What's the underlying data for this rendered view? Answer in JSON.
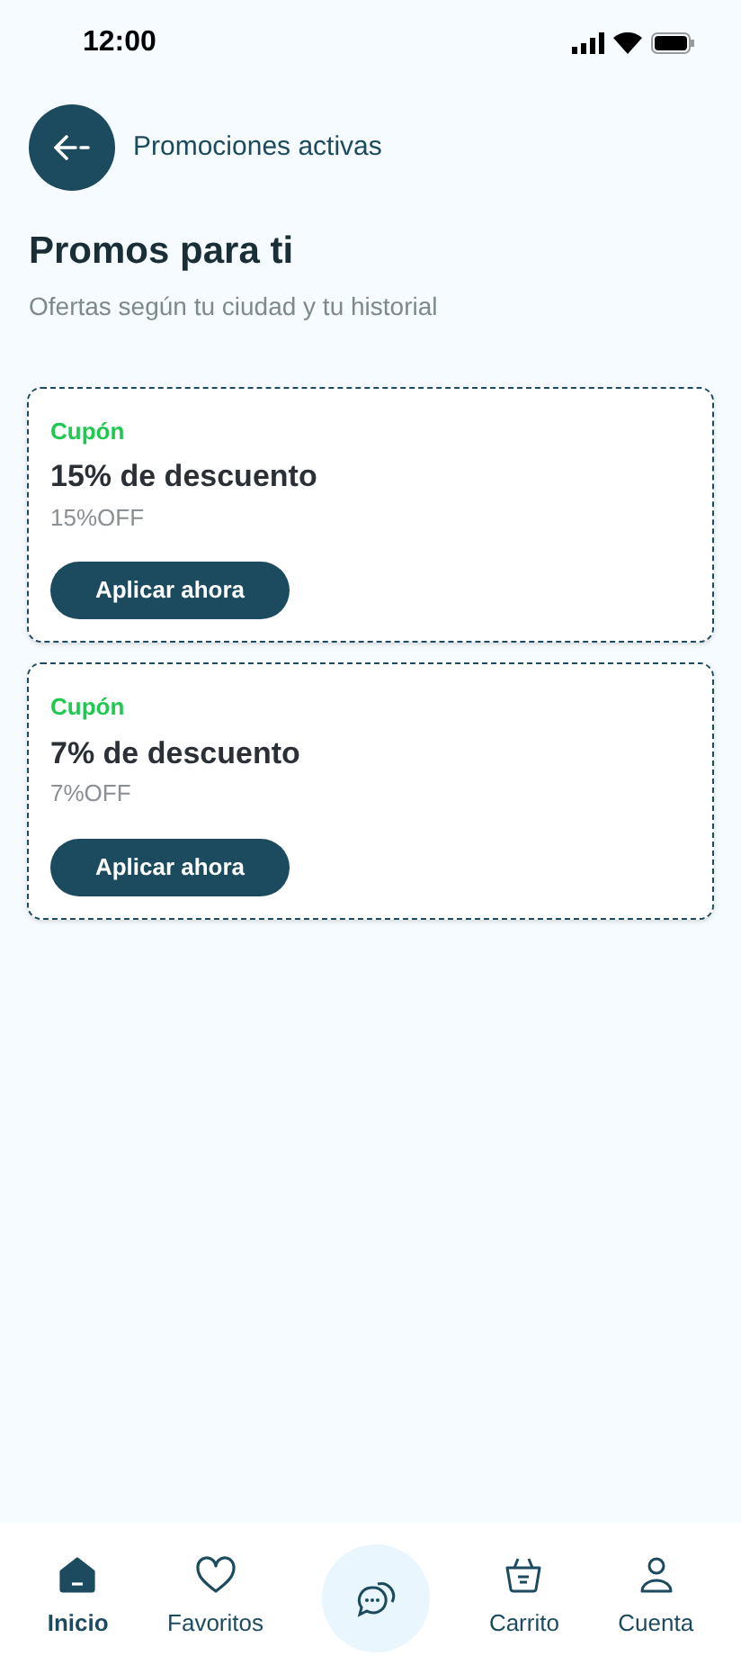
{
  "status_bar": {
    "time": "12:00"
  },
  "header": {
    "title": "Promociones activas"
  },
  "heading": "Promos para ti",
  "subtitle": "Ofertas según tu ciudad y tu historial",
  "coupons": [
    {
      "tag": "Cupón",
      "title": "15% de descuento",
      "code": "15%OFF",
      "button": "Aplicar ahora"
    },
    {
      "tag": "Cupón",
      "title": "7% de descuento",
      "code": "7%OFF",
      "button": "Aplicar ahora"
    }
  ],
  "bottom_nav": [
    {
      "kind": "home",
      "label": "Inicio",
      "selected": true
    },
    {
      "kind": "heart",
      "label": "Favoritos",
      "selected": false
    },
    {
      "kind": "chat",
      "selected": false
    },
    {
      "kind": "basket",
      "label": "Carrito",
      "selected": false
    },
    {
      "kind": "user",
      "label": "Cuenta",
      "selected": false
    }
  ]
}
